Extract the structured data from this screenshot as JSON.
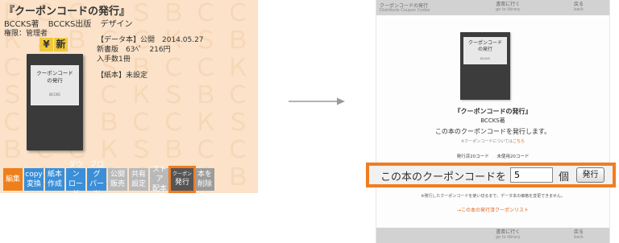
{
  "left_panel": {
    "title": "『クーポンコードの発行』",
    "author": "BCCKS著",
    "publisher": "BCCKS出版",
    "design": "デザイン",
    "rights": "権限：管理者",
    "badges": [
      "¥",
      "新"
    ],
    "book_cover": {
      "title_line1": "クーポンコード",
      "title_line2": "の発行",
      "author": "BCCKS"
    },
    "info": {
      "data_book": "【データ本】公開　2014.05.27",
      "edition": "新書版　63ﾍﾟ　216円",
      "purchases": "入手数1冊",
      "paper_book": "【紙本】未設定"
    },
    "toolbar": [
      {
        "label": "編集"
      },
      {
        "label": "copy\n変換"
      },
      {
        "label": "紙本\n作成"
      },
      {
        "label": "ダウン\nロード"
      },
      {
        "label": "ブログ\nパーツ"
      },
      {
        "label": "公開\n販売"
      },
      {
        "label": "共有\n設定"
      },
      {
        "label": "ストア\n配本"
      },
      {
        "small": "クーポン",
        "label": "発行"
      },
      {
        "label": "本を\n削除"
      }
    ]
  },
  "right_panel": {
    "header": {
      "title": "クーポンコードの発行",
      "subtitle": "Distribute Coupon Codes",
      "nav_library": "書斎に行く",
      "nav_library_en": "go to library",
      "nav_back": "戻る",
      "nav_back_en": "back"
    },
    "book_cover": {
      "title_line1": "クーポンコード",
      "title_line2": "の発行",
      "author": "BCCKS"
    },
    "title": "『クーポンコードの発行』",
    "author": "BCCKS著",
    "description": "この本のクーポンコードを発行します。",
    "note_prefix": "※クーポンコードについては",
    "note_link": "こちら",
    "issued": "発行済20コード",
    "unused": "未使用20コード",
    "issue_label": "この本のクーポンコードを",
    "issue_value": "5",
    "issue_unit": "個",
    "issue_button": "発行",
    "warning": "※発行したクーポンコードを使い切るまで、データ本の価格を変更できません。",
    "issued_list_link": "→この本の発行済クーポンリスト"
  },
  "colors": {
    "accent": "#f07d22",
    "left_bg": "#fbe2c8",
    "header_bg": "#d2d2d2"
  }
}
